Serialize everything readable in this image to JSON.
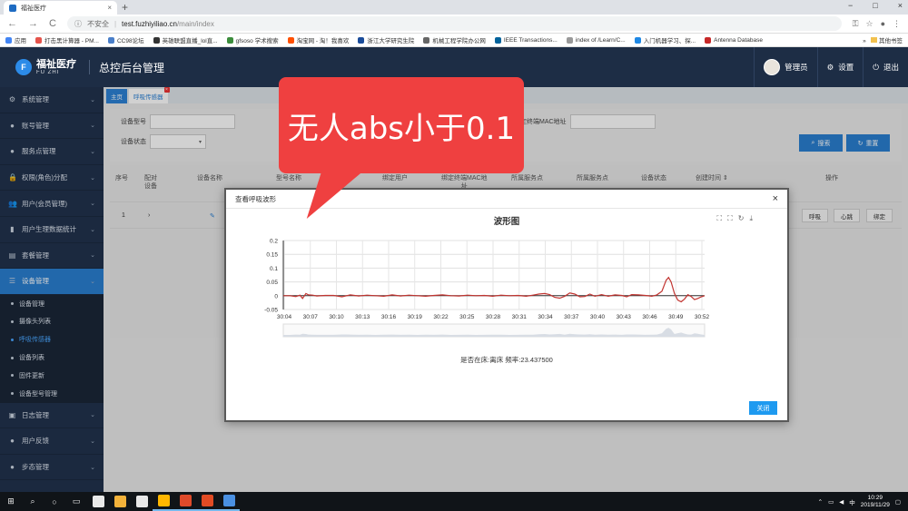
{
  "browser": {
    "tab_title": "福祉医疗",
    "tab_close": "×",
    "new_tab": "+",
    "win_controls": [
      "−",
      "□",
      "×"
    ],
    "nav": [
      "←",
      "→",
      "C"
    ],
    "security_label": "不安全",
    "url_host": "test.fuzhiyiliao.cn",
    "url_path": "/main/index",
    "right_icons": [
      "⚿",
      "☆",
      "●",
      "⋮"
    ],
    "bookmarks": [
      {
        "label": "应用",
        "color": "#4285f4"
      },
      {
        "label": "打击黑计算器 - PM...",
        "color": "#e5534b"
      },
      {
        "label": "CC98论坛",
        "color": "#4a7fc9"
      },
      {
        "label": "英雄联盟直播_lol直...",
        "color": "#333"
      },
      {
        "label": "gfsoso 学术搜索",
        "color": "#3c8d3c"
      },
      {
        "label": "淘宝网 - 淘！我喜欢",
        "color": "#ff5000"
      },
      {
        "label": "浙江大学研究生院",
        "color": "#1a4c9a"
      },
      {
        "label": "机械工程学院办公网",
        "color": "#666"
      },
      {
        "label": "IEEE Transactions...",
        "color": "#00629b"
      },
      {
        "label": "index of /Learn/C...",
        "color": "#999"
      },
      {
        "label": "入门机器学习、探...",
        "color": "#1e88e5"
      },
      {
        "label": "Antenna Database",
        "color": "#c62828"
      }
    ],
    "bookmarks_more": "»",
    "other_bookmarks": "其他书签"
  },
  "header": {
    "logo_mark": "F",
    "logo_cn": "福祉医疗",
    "logo_en": "FU ZHI",
    "title": "总控后台管理",
    "user_name": "管理员",
    "settings_label": "设置",
    "logout_label": "退出",
    "settings_icon": "⚙",
    "logout_icon": "⏻"
  },
  "sidebar": {
    "items_top": [
      {
        "icon": "⚙",
        "label": "系统管理"
      },
      {
        "icon": "●",
        "label": "账号管理"
      },
      {
        "icon": "●",
        "label": "服务点管理"
      },
      {
        "icon": "🔒",
        "label": "权限(角色)分配"
      },
      {
        "icon": "👥",
        "label": "用户(会员管理)"
      },
      {
        "icon": "▮",
        "label": "用户生理数据统计"
      },
      {
        "icon": "▤",
        "label": "套餐管理"
      }
    ],
    "active_item": {
      "icon": "☰",
      "label": "设备管理"
    },
    "subitems": [
      "设备管理",
      "摄像头列表",
      "呼吸传感器",
      "设备列表",
      "固件更新",
      "设备型号管理"
    ],
    "active_subitem_index": 2,
    "items_bottom": [
      {
        "icon": "▣",
        "label": "日志管理"
      },
      {
        "icon": "●",
        "label": "用户反馈"
      },
      {
        "icon": "●",
        "label": "步态管理"
      }
    ],
    "chevron": "⌄"
  },
  "page_tabs": {
    "home": "主页",
    "current": "呼吸传感器",
    "close": "×"
  },
  "search": {
    "model_label": "设备型号",
    "status_label": "设备状态",
    "mac_label": "绑定终端MAC地址",
    "select_arrow": "▾",
    "search_btn": "搜索",
    "reset_btn": "重置",
    "search_icon": "⌕",
    "reset_icon": "↻"
  },
  "table": {
    "headers": [
      "序号",
      "配对\n设备",
      "设备名称",
      "型号名称",
      "设备",
      "绑定用户",
      "绑定终端MAC地\n址",
      "所属服务点",
      "所属服务点",
      "设备状态",
      "创建时间 ⇕",
      "操作"
    ],
    "row": {
      "index": "1",
      "expand": "›",
      "edit_icon": "✎",
      "actions": [
        "呼吸",
        "心跳",
        "绑定"
      ]
    }
  },
  "modal": {
    "title": "查看呼吸波形",
    "close": "×",
    "chart_title": "波形图",
    "toolbox": [
      "⛶",
      "⛶",
      "↻",
      "⤓"
    ],
    "footer_text": "是否在床:离床   频率:23.437500",
    "close_btn": "关闭"
  },
  "callout": {
    "text": "无人abs小于0.1",
    "color": "#ef4040"
  },
  "chart_data": {
    "type": "line",
    "title": "波形图",
    "x": [
      "30:04",
      "30:07",
      "30:10",
      "30:13",
      "30:16",
      "30:19",
      "30:22",
      "30:25",
      "30:28",
      "30:31",
      "30:34",
      "30:37",
      "30:40",
      "30:43",
      "30:46",
      "30:49",
      "30:52"
    ],
    "ylim": [
      -0.05,
      0.2
    ],
    "yticks": [
      0.2,
      0.15,
      0.1,
      0.05,
      0,
      -0.05
    ],
    "grid": true,
    "series": [
      {
        "color": "#c23531",
        "points": [
          [
            0,
            0
          ],
          [
            0.8,
            0
          ],
          [
            1.5,
            -0.003
          ],
          [
            2.0,
            0.002
          ],
          [
            2.3,
            -0.01
          ],
          [
            2.7,
            0.008
          ],
          [
            3.0,
            0.003
          ],
          [
            3.5,
            0.002
          ],
          [
            4.0,
            -0.001
          ],
          [
            5.0,
            0.001
          ],
          [
            6.0,
            0.001
          ],
          [
            7.0,
            -0.004
          ],
          [
            8.0,
            0.003
          ],
          [
            9.0,
            -0.001
          ],
          [
            10.0,
            0.002
          ],
          [
            11.0,
            0
          ],
          [
            12.0,
            -0.002
          ],
          [
            13.0,
            0.003
          ],
          [
            14.0,
            -0.001
          ],
          [
            15.0,
            0.002
          ],
          [
            16.0,
            0
          ],
          [
            17.0,
            -0.002
          ],
          [
            18.0,
            0.001
          ],
          [
            19.0,
            0.003
          ],
          [
            20.0,
            0
          ],
          [
            21.0,
            -0.001
          ],
          [
            22.0,
            0.002
          ],
          [
            23.0,
            0
          ],
          [
            24.0,
            0.001
          ],
          [
            25.0,
            -0.002
          ],
          [
            26.0,
            0.002
          ],
          [
            27.0,
            0
          ],
          [
            28.0,
            0.001
          ],
          [
            29.0,
            -0.002
          ],
          [
            29.8,
            0.002
          ],
          [
            30.5,
            0.006
          ],
          [
            31.2,
            0.008
          ],
          [
            31.8,
            0.004
          ],
          [
            32.4,
            -0.006
          ],
          [
            33.0,
            -0.009
          ],
          [
            33.6,
            -0.002
          ],
          [
            34.2,
            0.01
          ],
          [
            34.8,
            0.006
          ],
          [
            35.4,
            -0.004
          ],
          [
            36.0,
            -0.003
          ],
          [
            36.6,
            0.006
          ],
          [
            37.2,
            -0.002
          ],
          [
            38.0,
            0.004
          ],
          [
            38.8,
            -0.002
          ],
          [
            39.6,
            0.003
          ],
          [
            40.4,
            0.001
          ],
          [
            41.0,
            -0.004
          ],
          [
            41.6,
            0.004
          ],
          [
            42.4,
            0.003
          ],
          [
            43.2,
            0.001
          ],
          [
            44.0,
            -0.002
          ],
          [
            44.6,
            0.003
          ],
          [
            45.2,
            0.016
          ],
          [
            45.7,
            0.056
          ],
          [
            46.0,
            0.066
          ],
          [
            46.3,
            0.05
          ],
          [
            46.7,
            0.008
          ],
          [
            47.1,
            -0.016
          ],
          [
            47.5,
            -0.022
          ],
          [
            47.9,
            -0.012
          ],
          [
            48.3,
            0.004
          ],
          [
            48.7,
            -0.003
          ],
          [
            49.1,
            -0.014
          ],
          [
            49.5,
            -0.01
          ],
          [
            49.9,
            -0.004
          ],
          [
            50.3,
            0.0
          ]
        ]
      }
    ],
    "footer": "是否在床:离床   频率:23.437500"
  },
  "taskbar": {
    "time": "10:29",
    "date": "2019/11/29",
    "ime": "中",
    "apps": [
      {
        "color": "#e9e9e9"
      },
      {
        "color": "#f3b23a"
      },
      {
        "color": "#e8e8e8"
      },
      {
        "color": "#ffb700"
      },
      {
        "color": "#de4a2a"
      },
      {
        "color": "#e14b24"
      },
      {
        "color": "#4a90e2"
      }
    ]
  }
}
